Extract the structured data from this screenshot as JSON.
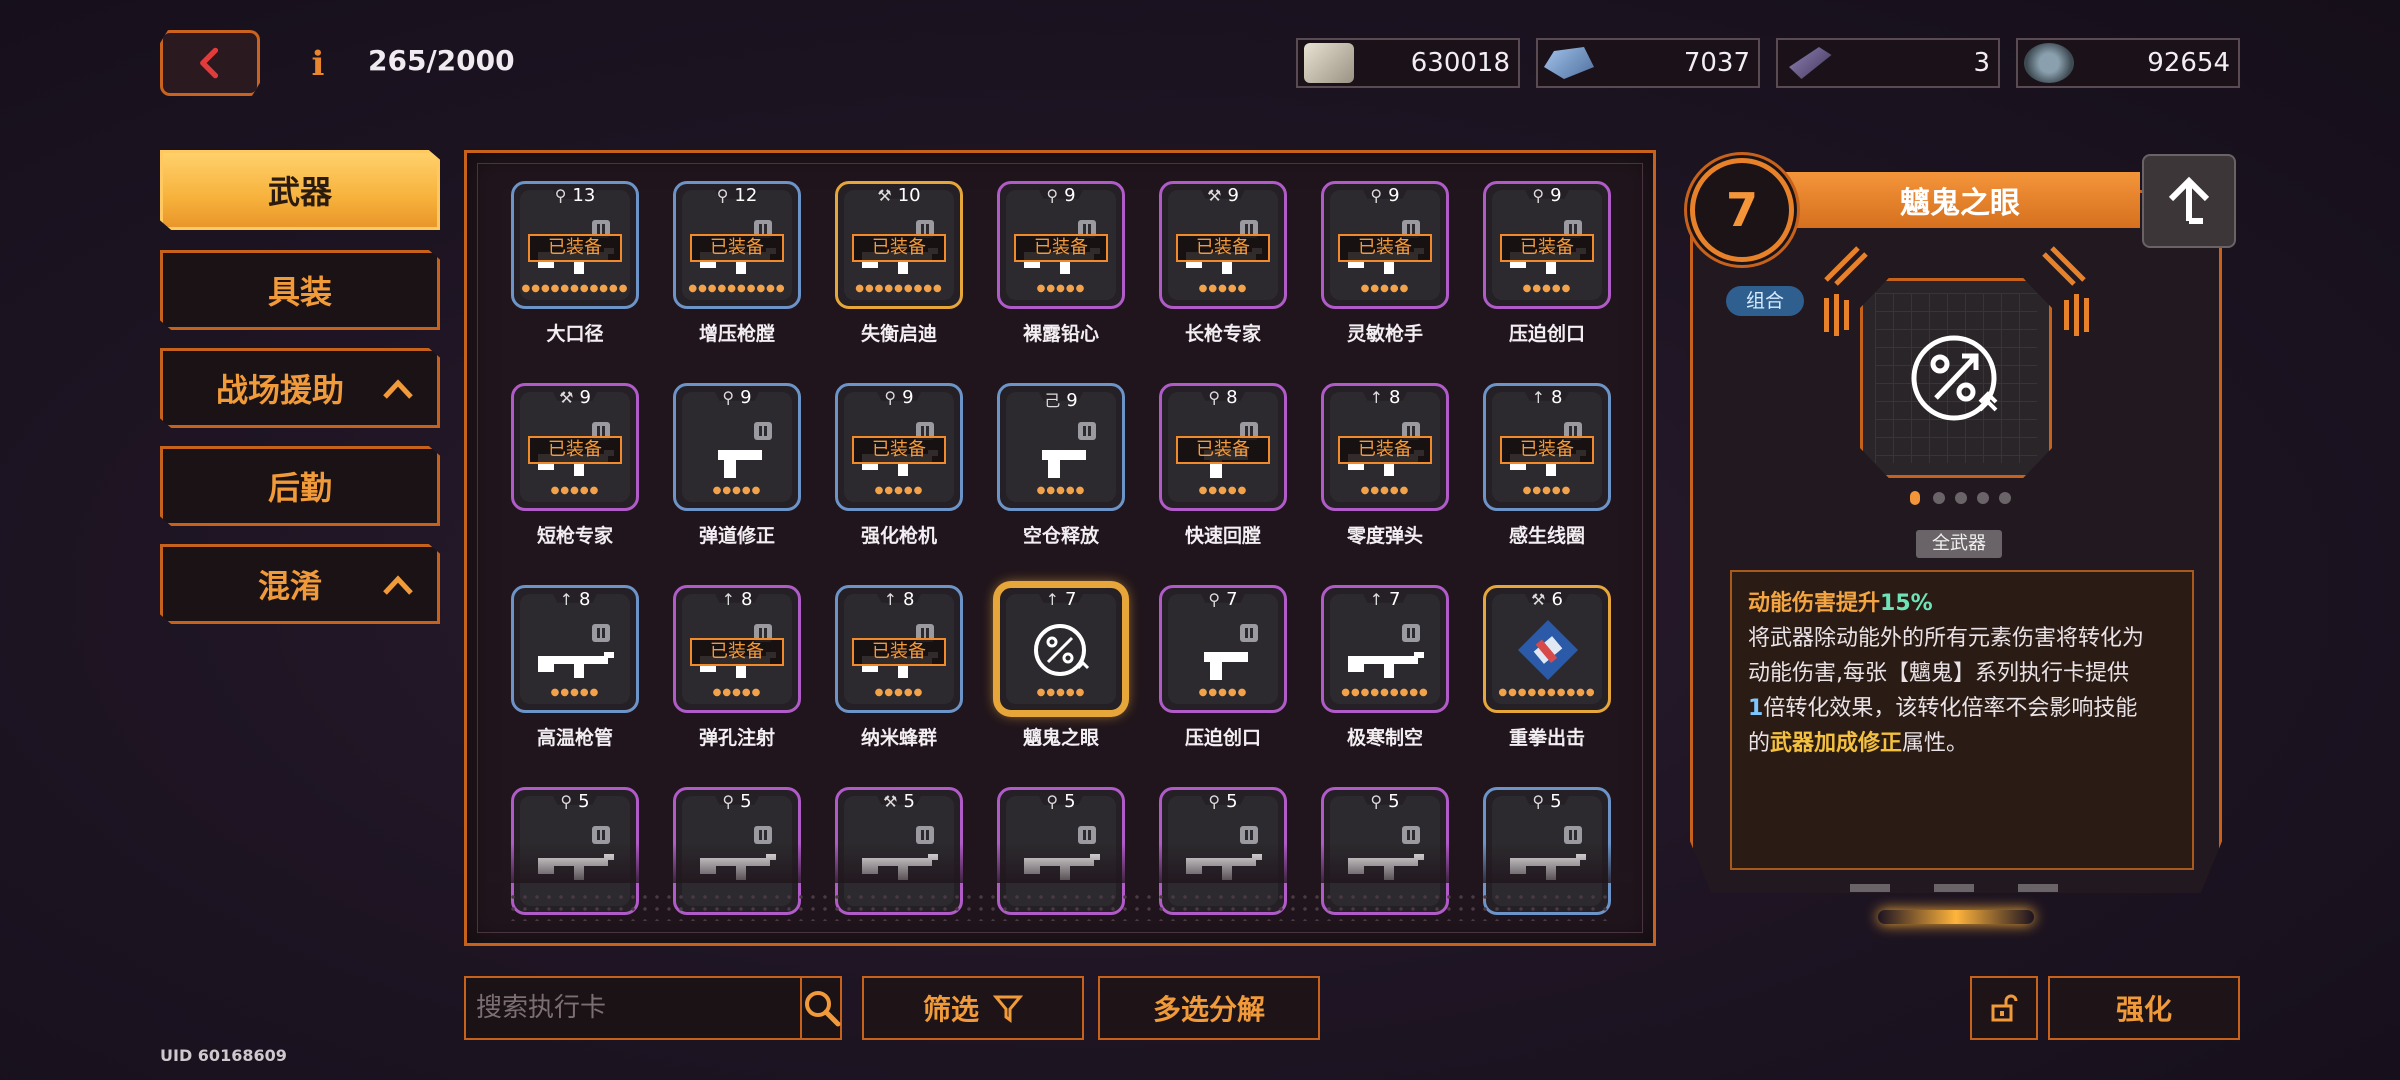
{
  "header": {
    "counter": "265/2000",
    "info_icon": "info-icon",
    "currencies": [
      {
        "name": "cash-icon",
        "value": "630018",
        "color": "#d8d0c0"
      },
      {
        "name": "ingot-icon",
        "value": "7037",
        "color": "#7fa8e0"
      },
      {
        "name": "chip-icon",
        "value": "3",
        "color": "#8a6fb0"
      },
      {
        "name": "gear-icon",
        "value": "92654",
        "color": "#6a7c8a"
      }
    ]
  },
  "sidebar": {
    "items": [
      {
        "label": "武器",
        "active": true
      },
      {
        "label": "具装",
        "active": false
      },
      {
        "label": "战场援助",
        "active": false,
        "caret": true
      },
      {
        "label": "后勤",
        "active": false
      },
      {
        "label": "混淆",
        "active": false,
        "caret": true
      }
    ]
  },
  "equipped_label": "已装备",
  "cards": [
    {
      "name": "大口径",
      "level": "13",
      "sym": "⚲",
      "equipped": true,
      "border": "blue",
      "dots": "●●●●●●●●●●●"
    },
    {
      "name": "增压枪膛",
      "level": "12",
      "sym": "⚲",
      "equipped": true,
      "border": "blue",
      "dots": "●●●●●●●●●●"
    },
    {
      "name": "失衡启迪",
      "level": "10",
      "sym": "⚒",
      "equipped": true,
      "border": "gold",
      "dots": "●●●●●●●●●"
    },
    {
      "name": "裸露铅心",
      "level": "9",
      "sym": "⚲",
      "equipped": true,
      "border": "purple",
      "dots": "●●●●●"
    },
    {
      "name": "长枪专家",
      "level": "9",
      "sym": "⚒",
      "equipped": true,
      "border": "purple",
      "dots": "●●●●●"
    },
    {
      "name": "灵敏枪手",
      "level": "9",
      "sym": "⚲",
      "equipped": true,
      "border": "purple",
      "dots": "●●●●●"
    },
    {
      "name": "压迫创口",
      "level": "9",
      "sym": "⚲",
      "equipped": true,
      "border": "purple",
      "dots": "●●●●●"
    },
    {
      "name": "短枪专家",
      "level": "9",
      "sym": "⚒",
      "equipped": true,
      "border": "purple",
      "dots": "●●●●●"
    },
    {
      "name": "弹道修正",
      "level": "9",
      "sym": "⚲",
      "equipped": false,
      "border": "blue",
      "dots": "●●●●●"
    },
    {
      "name": "强化枪机",
      "level": "9",
      "sym": "⚲",
      "equipped": true,
      "border": "blue",
      "dots": "●●●●●"
    },
    {
      "name": "空仓释放",
      "level": "9",
      "sym": "己",
      "equipped": false,
      "border": "blue",
      "dots": "●●●●●"
    },
    {
      "name": "快速回膛",
      "level": "8",
      "sym": "⚲",
      "equipped": true,
      "border": "purple",
      "dots": "●●●●●"
    },
    {
      "name": "零度弹头",
      "level": "8",
      "sym": "↑",
      "equipped": true,
      "border": "purple",
      "dots": "●●●●●"
    },
    {
      "name": "感生线圈",
      "level": "8",
      "sym": "↑",
      "equipped": true,
      "border": "blue",
      "dots": "●●●●●"
    },
    {
      "name": "高温枪管",
      "level": "8",
      "sym": "↑",
      "equipped": false,
      "border": "blue",
      "dots": "●●●●●"
    },
    {
      "name": "弹孔注射",
      "level": "8",
      "sym": "↑",
      "equipped": true,
      "border": "purple",
      "dots": "●●●●●"
    },
    {
      "name": "纳米蜂群",
      "level": "8",
      "sym": "↑",
      "equipped": true,
      "border": "blue",
      "dots": "●●●●●"
    },
    {
      "name": "魑鬼之眼",
      "level": "7",
      "sym": "↑",
      "equipped": false,
      "border": "gold",
      "dots": "●●●●●",
      "selected": true
    },
    {
      "name": "压迫创口",
      "level": "7",
      "sym": "⚲",
      "equipped": false,
      "border": "purple",
      "dots": "●●●●●"
    },
    {
      "name": "极寒制空",
      "level": "7",
      "sym": "↑",
      "equipped": false,
      "border": "purple",
      "dots": "●●●●●●●●●"
    },
    {
      "name": "重拳出击",
      "level": "6",
      "sym": "⚒",
      "equipped": false,
      "border": "gold",
      "dots": "●●●●●●●●●●"
    },
    {
      "name": "",
      "level": "5",
      "sym": "⚲",
      "equipped": false,
      "border": "purple",
      "dots": ""
    },
    {
      "name": "",
      "level": "5",
      "sym": "⚲",
      "equipped": false,
      "border": "purple",
      "dots": ""
    },
    {
      "name": "",
      "level": "5",
      "sym": "⚒",
      "equipped": false,
      "border": "purple",
      "dots": ""
    },
    {
      "name": "",
      "level": "5",
      "sym": "⚲",
      "equipped": false,
      "border": "purple",
      "dots": ""
    },
    {
      "name": "",
      "level": "5",
      "sym": "⚲",
      "equipped": false,
      "border": "purple",
      "dots": ""
    },
    {
      "name": "",
      "level": "5",
      "sym": "⚲",
      "equipped": false,
      "border": "purple",
      "dots": ""
    },
    {
      "name": "",
      "level": "5",
      "sym": "⚲",
      "equipped": false,
      "border": "blue",
      "dots": ""
    }
  ],
  "detail": {
    "rank": "7",
    "title": "魑鬼之眼",
    "tag": "组合",
    "scope": "全武器",
    "desc": {
      "line1_a": "动能伤害提升",
      "line1_b": "15%",
      "line2": "将武器除动能外的所有元素伤害将转化为",
      "line3": "动能伤害,每张【魑鬼】系列执行卡提供",
      "line4_a": "1",
      "line4_b": "倍转化效果，该转化倍率不会影响技能",
      "line5_a": "的",
      "line5_b": "武器加成修正",
      "line5_c": "属性。"
    }
  },
  "bottom": {
    "search_placeholder": "搜索执行卡",
    "filter_label": "筛选",
    "dismantle_label": "多选分解",
    "enhance_label": "强化",
    "uid": "UID 60168609"
  },
  "colors": {
    "accent": "#c7621d",
    "accent_light": "#f19a3a",
    "blue_border": "#7fa8d8",
    "purple_border": "#b05bc8",
    "gold_border": "#e7a63a"
  }
}
